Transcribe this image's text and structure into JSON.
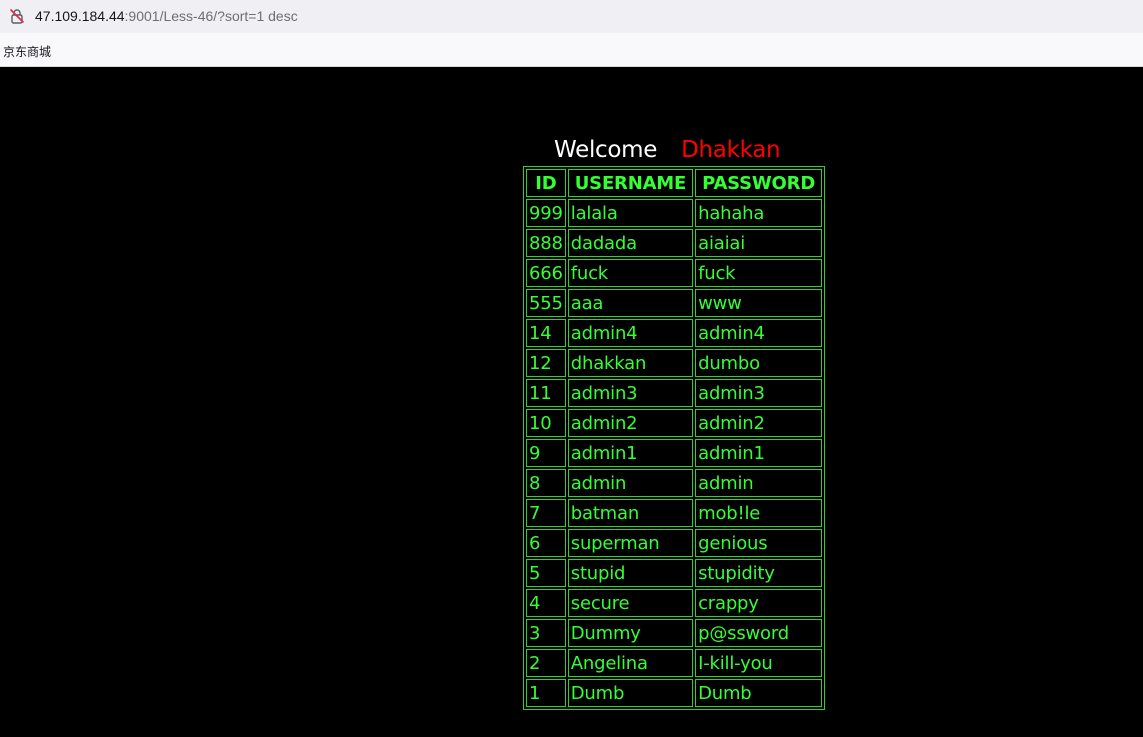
{
  "browser": {
    "url_host": "47.109.184.44",
    "url_rest": ":9001/Less-46/?sort=1 desc",
    "bookmark": "京东商城"
  },
  "page": {
    "welcome": "Welcome",
    "username": "Dhakkan"
  },
  "table": {
    "headers": [
      "ID",
      "USERNAME",
      "PASSWORD"
    ],
    "rows": [
      {
        "id": "999",
        "username": "lalala",
        "password": "hahaha"
      },
      {
        "id": "888",
        "username": "dadada",
        "password": "aiaiai"
      },
      {
        "id": "666",
        "username": "fuck",
        "password": "fuck"
      },
      {
        "id": "555",
        "username": "aaa",
        "password": "www"
      },
      {
        "id": "14",
        "username": "admin4",
        "password": "admin4"
      },
      {
        "id": "12",
        "username": "dhakkan",
        "password": "dumbo"
      },
      {
        "id": "11",
        "username": "admin3",
        "password": "admin3"
      },
      {
        "id": "10",
        "username": "admin2",
        "password": "admin2"
      },
      {
        "id": "9",
        "username": "admin1",
        "password": "admin1"
      },
      {
        "id": "8",
        "username": "admin",
        "password": "admin"
      },
      {
        "id": "7",
        "username": "batman",
        "password": "mob!le"
      },
      {
        "id": "6",
        "username": "superman",
        "password": "genious"
      },
      {
        "id": "5",
        "username": "stupid",
        "password": "stupidity"
      },
      {
        "id": "4",
        "username": "secure",
        "password": "crappy"
      },
      {
        "id": "3",
        "username": "Dummy",
        "password": "p@ssword"
      },
      {
        "id": "2",
        "username": "Angelina",
        "password": "I-kill-you"
      },
      {
        "id": "1",
        "username": "Dumb",
        "password": "Dumb"
      }
    ]
  },
  "colors": {
    "table_text": "#33ff33",
    "table_border": "#33cc33",
    "welcome": "#ffffff",
    "username": "#ff0000",
    "background": "#000000"
  }
}
